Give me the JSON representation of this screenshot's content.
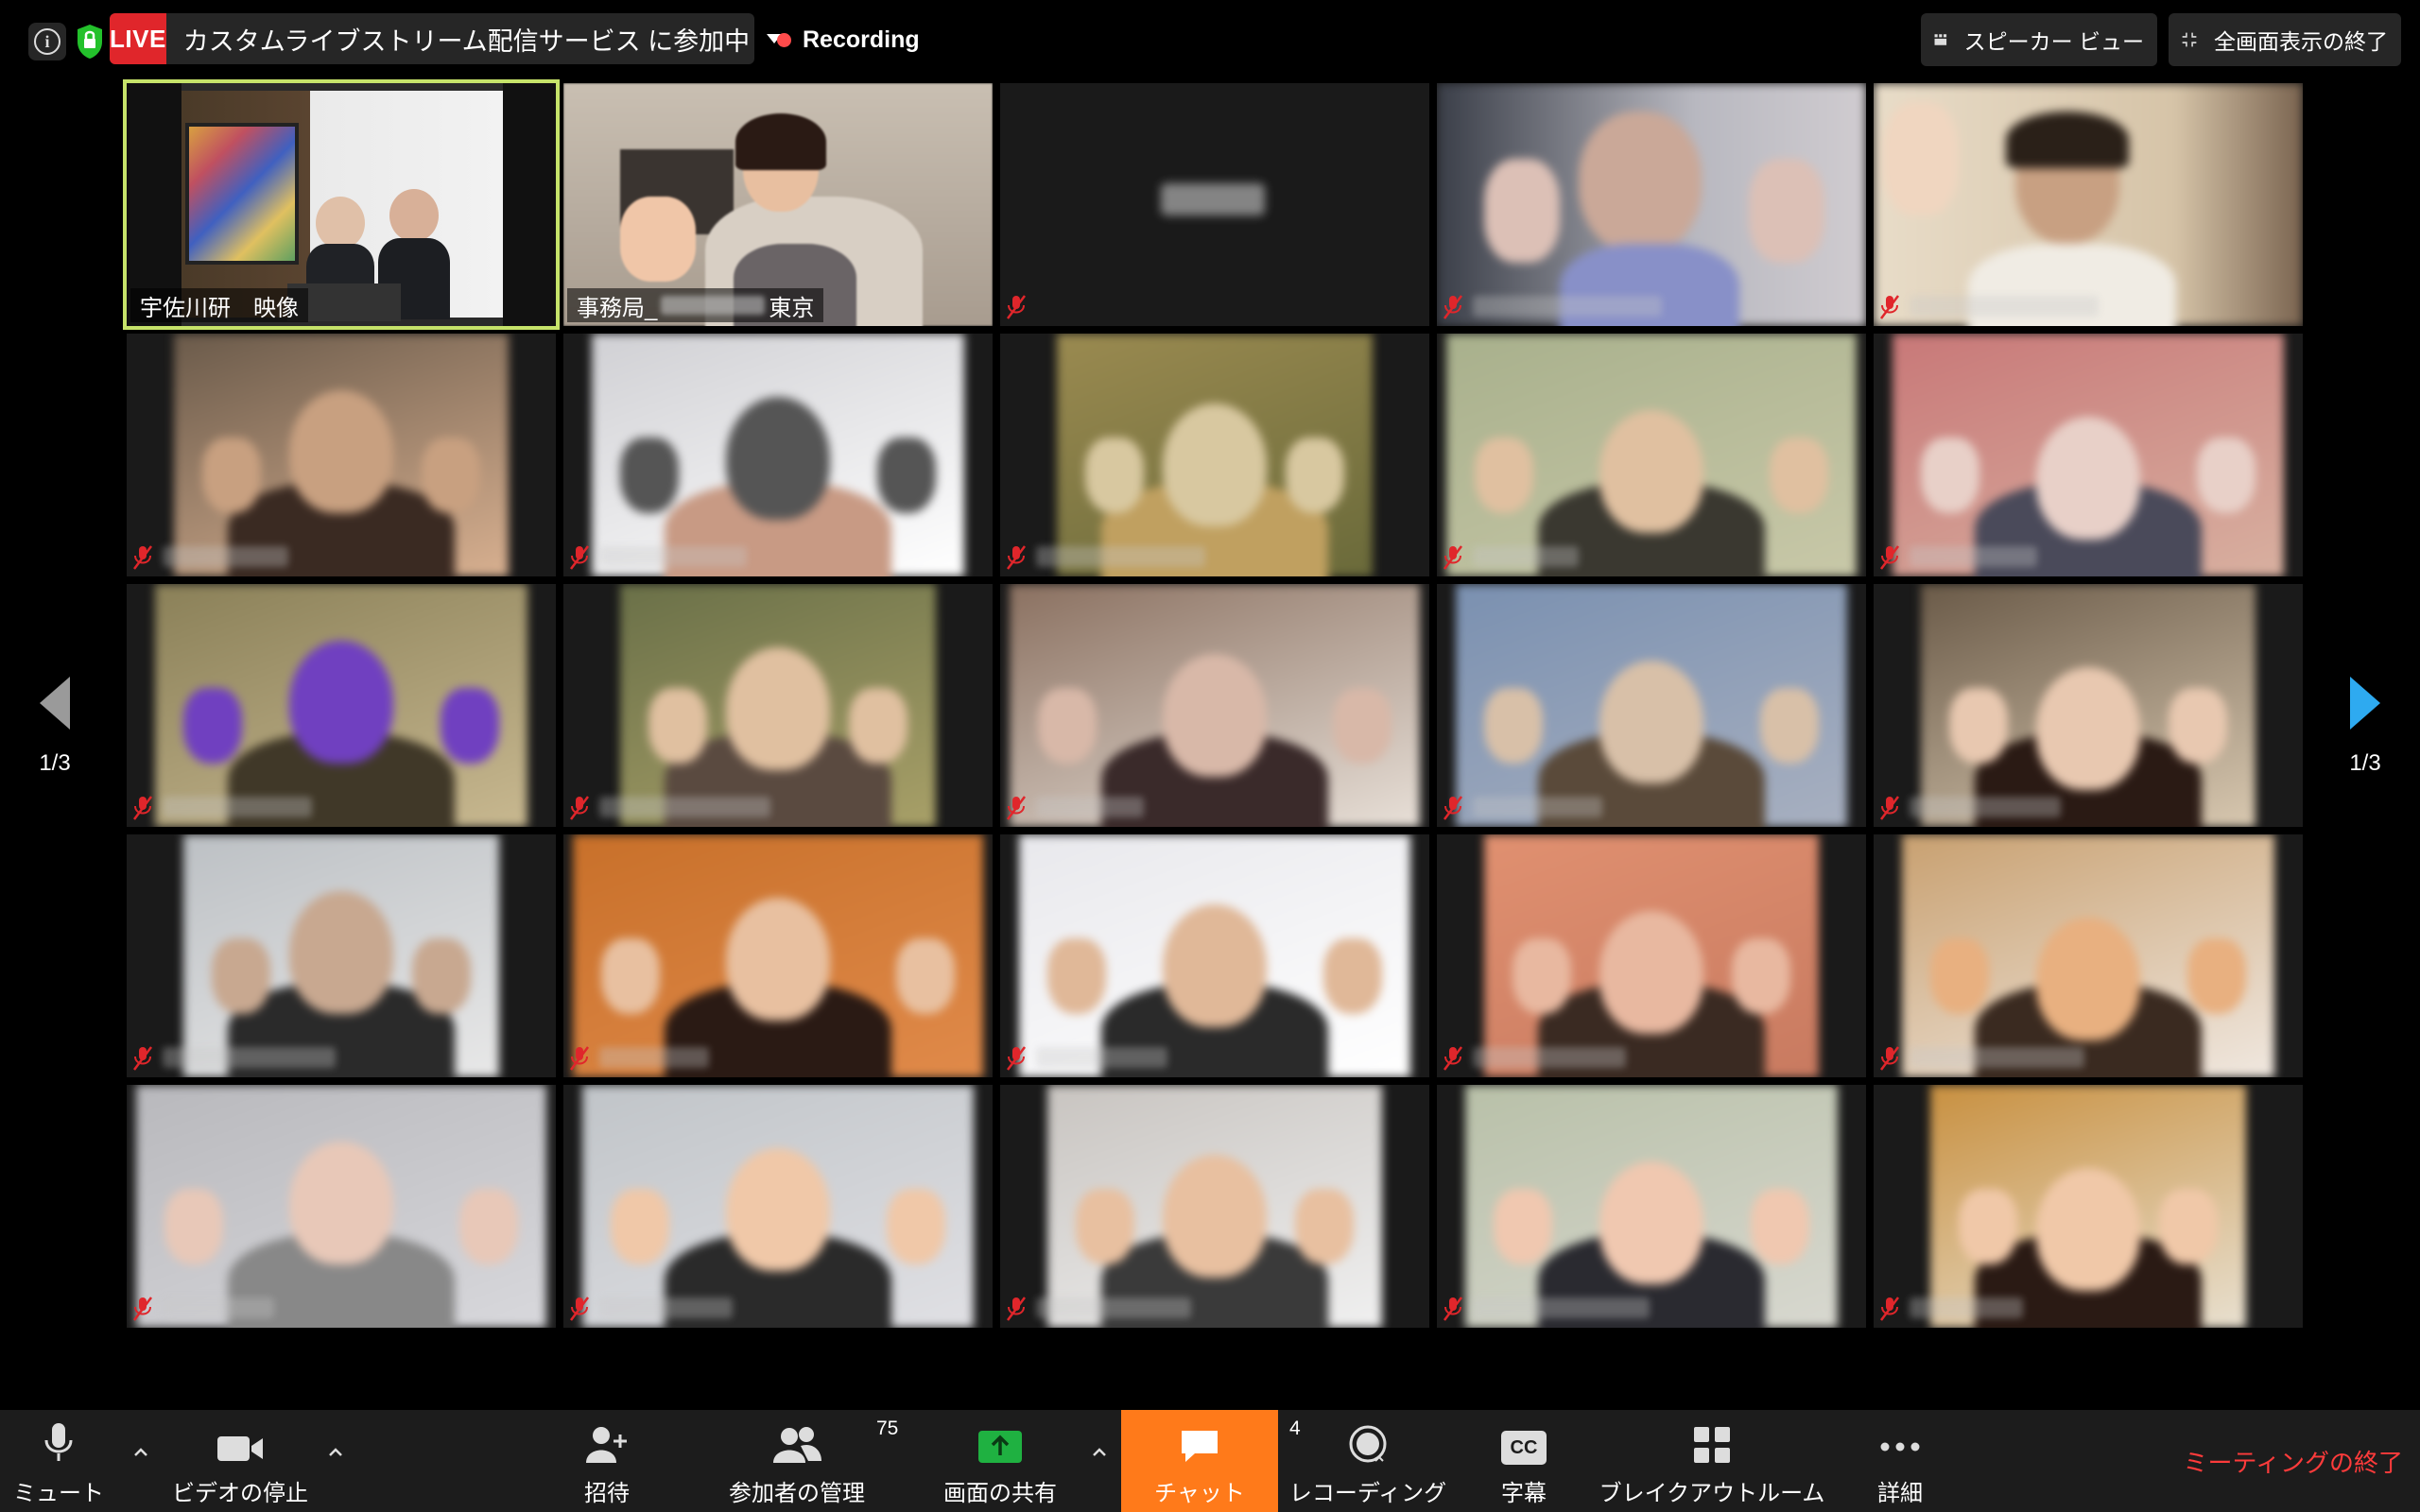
{
  "topbar": {
    "live_badge": "LIVE",
    "live_status": "カスタムライブストリーム配信サービス に参加中",
    "recording": "Recording",
    "speaker_view": "スピーカー ビュー",
    "exit_fullscreen": "全画面表示の終了"
  },
  "pager": {
    "left_label": "1/3",
    "right_label": "1/3"
  },
  "tiles": [
    {
      "name": "宇佐川研　映像",
      "active": true
    },
    {
      "name": "事務局_",
      "name_suffix": "東京"
    }
  ],
  "toolbar": {
    "mute": "ミュート",
    "stop_video": "ビデオの停止",
    "invite": "招待",
    "manage_participants": "参加者の管理",
    "participant_count": "75",
    "share_screen": "画面の共有",
    "chat": "チャット",
    "chat_count": "4",
    "recording": "レコーディング",
    "captions": "字幕",
    "captions_icon": "CC",
    "breakout_rooms": "ブレイクアウトルーム",
    "more": "詳細",
    "end_meeting": "ミーティングの終了"
  },
  "colors": {
    "live_red": "#e0262b",
    "active_speaker": "#c6e36a",
    "chat_active": "#ff7a1a",
    "share_green": "#1fb141",
    "end_red": "#ff3b3b",
    "pager_blue": "#2eaaf0"
  }
}
